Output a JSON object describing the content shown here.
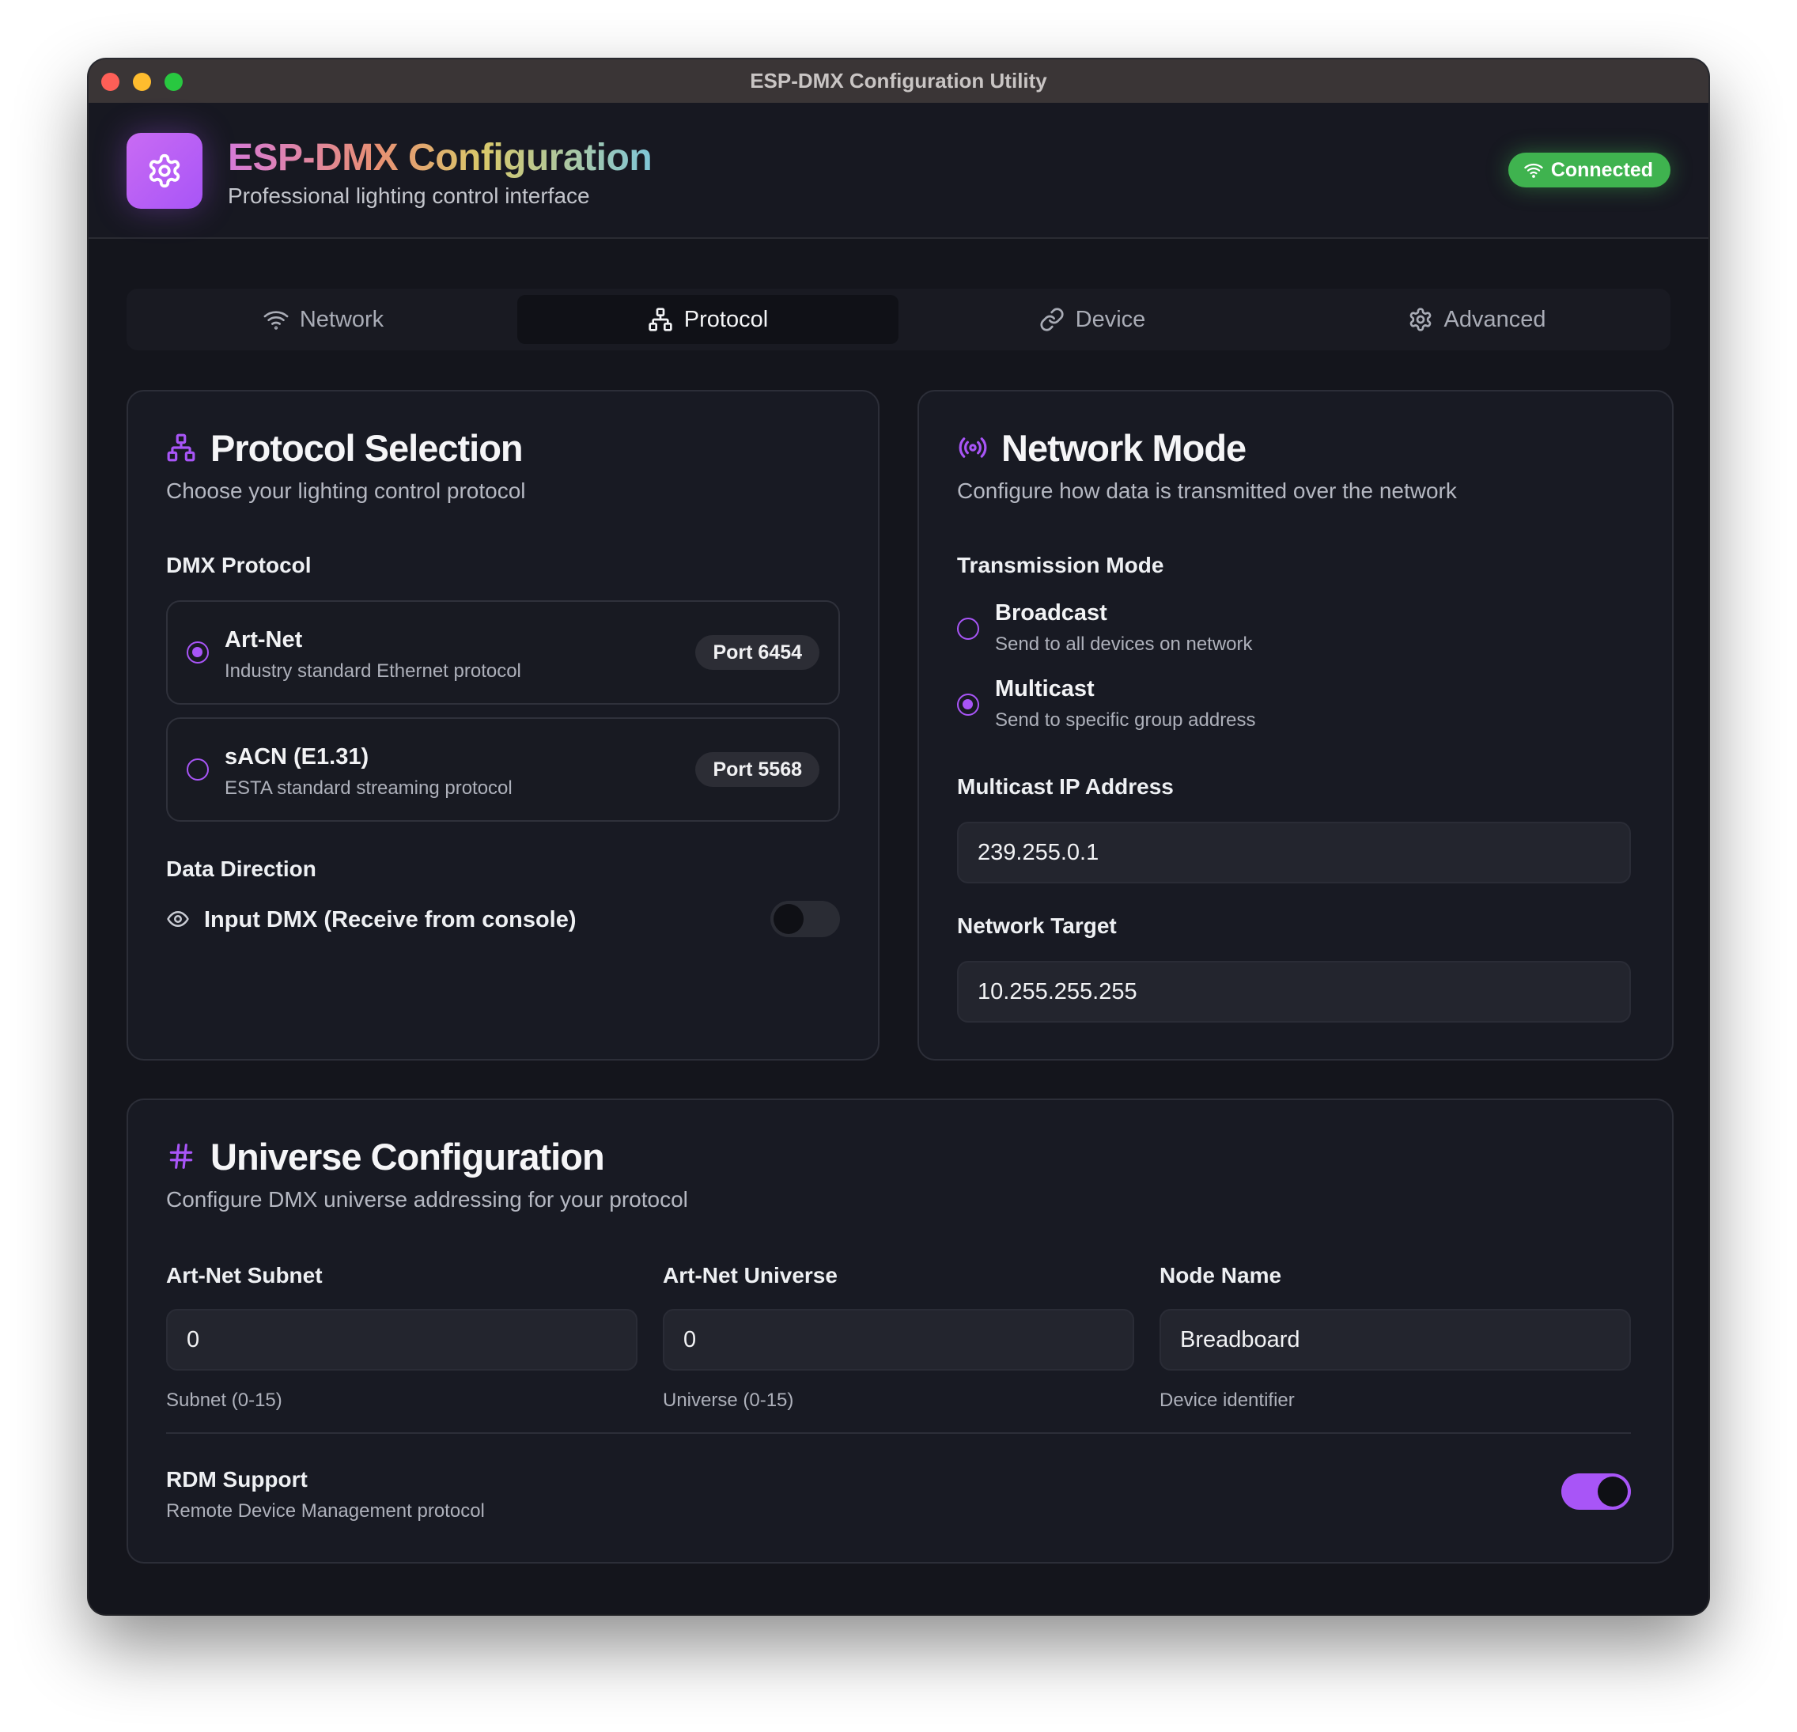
{
  "window": {
    "title": "ESP-DMX Configuration Utility"
  },
  "header": {
    "title": "ESP-DMX Configuration",
    "subtitle": "Professional lighting control interface",
    "status": "Connected",
    "logo_icon": "gear-icon"
  },
  "tabs": [
    {
      "label": "Network",
      "icon": "wifi-icon",
      "active": false
    },
    {
      "label": "Protocol",
      "icon": "network-tree-icon",
      "active": true
    },
    {
      "label": "Device",
      "icon": "link-icon",
      "active": false
    },
    {
      "label": "Advanced",
      "icon": "gear-icon",
      "active": false
    }
  ],
  "protocol_selection": {
    "title": "Protocol Selection",
    "description": "Choose your lighting control protocol",
    "dmx_protocol_label": "DMX Protocol",
    "options": [
      {
        "name": "Art-Net",
        "description": "Industry standard Ethernet protocol",
        "port": "Port 6454",
        "selected": true
      },
      {
        "name": "sACN (E1.31)",
        "description": "ESTA standard streaming protocol",
        "port": "Port 5568",
        "selected": false
      }
    ],
    "data_direction_label": "Data Direction",
    "input_dmx_label": "Input DMX (Receive from console)",
    "input_dmx_enabled": false
  },
  "network_mode": {
    "title": "Network Mode",
    "description": "Configure how data is transmitted over the network",
    "transmission_mode_label": "Transmission Mode",
    "modes": [
      {
        "name": "Broadcast",
        "description": "Send to all devices on network",
        "selected": false
      },
      {
        "name": "Multicast",
        "description": "Send to specific group address",
        "selected": true
      }
    ],
    "multicast_ip_label": "Multicast IP Address",
    "multicast_ip_value": "239.255.0.1",
    "network_target_label": "Network Target",
    "network_target_value": "10.255.255.255"
  },
  "universe_configuration": {
    "title": "Universe Configuration",
    "description": "Configure DMX universe addressing for your protocol",
    "fields": [
      {
        "label": "Art-Net Subnet",
        "value": "0",
        "hint": "Subnet (0-15)"
      },
      {
        "label": "Art-Net Universe",
        "value": "0",
        "hint": "Universe (0-15)"
      },
      {
        "label": "Node Name",
        "value": "Breadboard",
        "hint": "Device identifier"
      }
    ],
    "rdm_label": "RDM Support",
    "rdm_description": "Remote Device Management protocol",
    "rdm_enabled": true
  },
  "colors": {
    "accent": "#a855f7",
    "connected": "#3fb34f",
    "background": "#14151c",
    "card": "#181a23"
  }
}
